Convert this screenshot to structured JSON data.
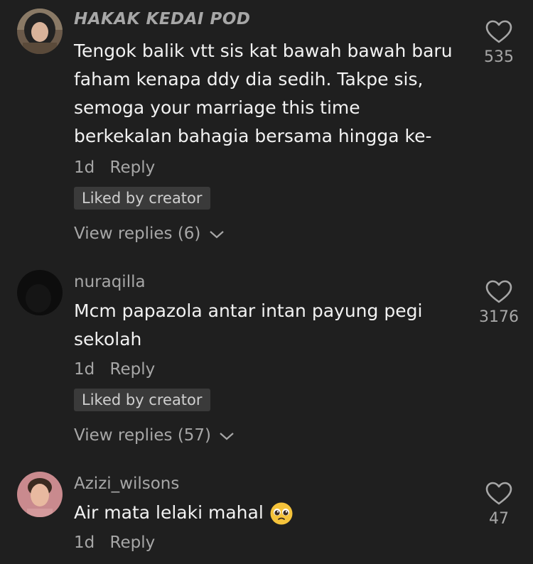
{
  "comments": [
    {
      "username": "HAKAK KEDAI POD",
      "text": "Tengok balik vtt sis kat bawah bawah baru faham kenapa ddy dia sedih. Takpe sis, semoga your marriage this time berkekalan bahagia bersama hingga ke-",
      "time": "1d",
      "reply_label": "Reply",
      "badge": "Liked by creator",
      "view_replies": "View replies (6)",
      "likes": "535"
    },
    {
      "username": "nuraqilla",
      "text": "Mcm papazola antar intan payung pegi sekolah",
      "time": "1d",
      "reply_label": "Reply",
      "badge": "Liked by creator",
      "view_replies": "View replies (57)",
      "likes": "3176"
    },
    {
      "username": "Azizi_wilsons",
      "text": "Air mata lelaki mahal",
      "emoji": "pleading-face-emoji",
      "time": "1d",
      "reply_label": "Reply",
      "likes": "47"
    }
  ],
  "colors": {
    "background": "#1f1f1f",
    "secondary_text": "#a7a7a7",
    "badge_bg": "#3a3a3a"
  }
}
